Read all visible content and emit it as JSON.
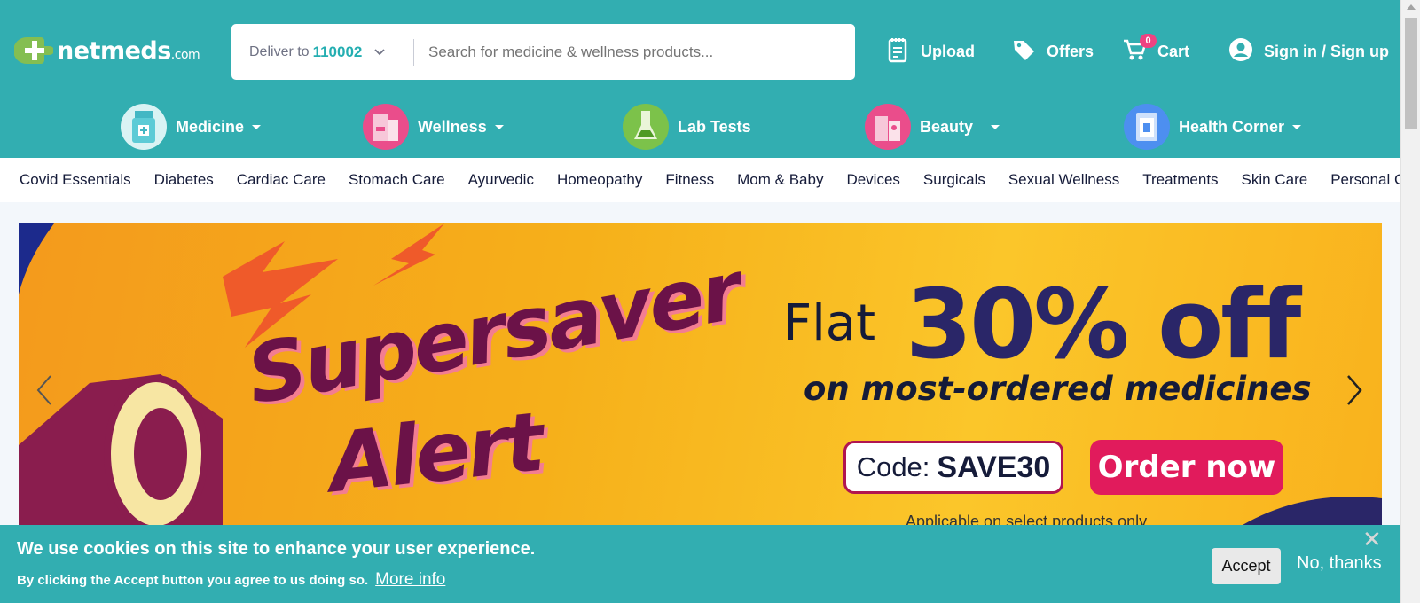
{
  "brand": {
    "logo_text": "netmeds",
    "logo_suffix": ".com",
    "color": "#32aeb1"
  },
  "search": {
    "deliver_label": "Deliver to",
    "pincode": "110002",
    "placeholder": "Search for medicine & wellness products..."
  },
  "top_links": {
    "upload": "Upload",
    "offers": "Offers",
    "cart": "Cart",
    "cart_count": "0",
    "signin": "Sign in / Sign up"
  },
  "categories": [
    {
      "label": "Medicine"
    },
    {
      "label": "Wellness"
    },
    {
      "label": "Lab Tests"
    },
    {
      "label": "Beauty"
    },
    {
      "label": "Health Corner"
    }
  ],
  "subnav": [
    "Covid Essentials",
    "Diabetes",
    "Cardiac Care",
    "Stomach Care",
    "Ayurvedic",
    "Homeopathy",
    "Fitness",
    "Mom & Baby",
    "Devices",
    "Surgicals",
    "Sexual Wellness",
    "Treatments",
    "Skin Care",
    "Personal Care"
  ],
  "banner": {
    "line1": "Supersaver",
    "line2": "Alert",
    "flat": "Flat",
    "percent": "30% off",
    "subtitle": "on most-ordered medicines",
    "code_label": "Code:",
    "code": "SAVE30",
    "cta": "Order now",
    "footnote": "Applicable on select products only"
  },
  "cookie": {
    "title": "We use cookies on this site to enhance your user experience.",
    "body": "By clicking the Accept button you agree to us doing so.",
    "more": "More info",
    "accept": "Accept",
    "decline": "No, thanks"
  }
}
